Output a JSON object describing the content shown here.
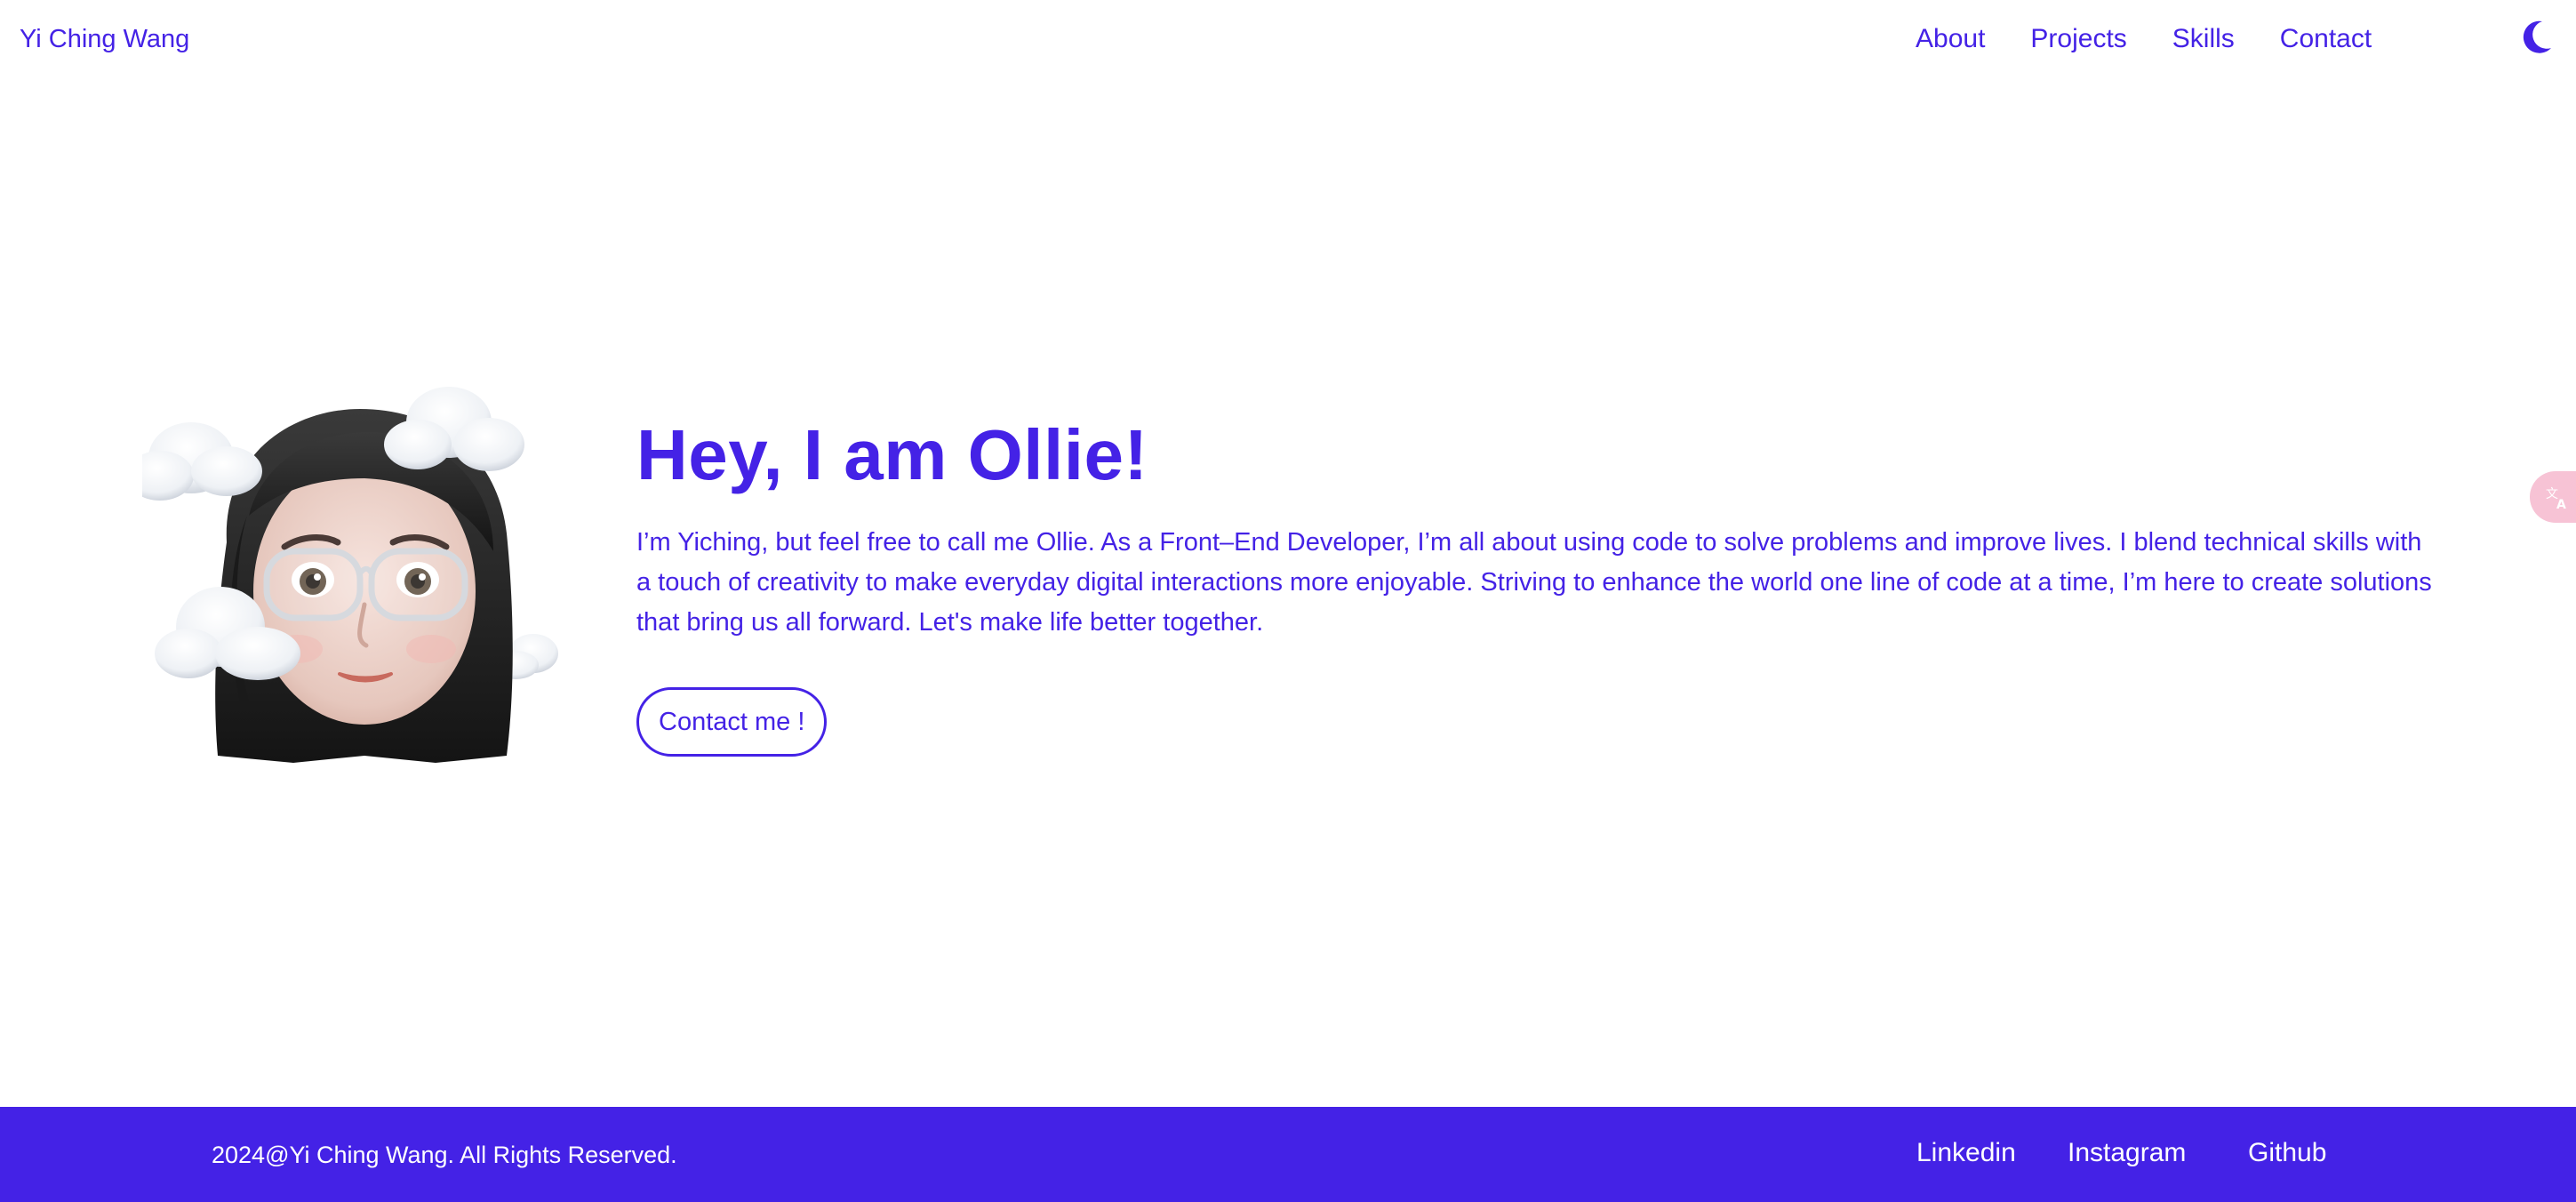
{
  "header": {
    "brand": "Yi Ching Wang",
    "nav": [
      {
        "label": "About"
      },
      {
        "label": "Projects"
      },
      {
        "label": "Skills"
      },
      {
        "label": "Contact"
      }
    ]
  },
  "hero": {
    "title": "Hey, I am Ollie!",
    "description": "I’m Yiching, but feel free to call me Ollie. As a Front–End Developer, I’m all about using code to solve problems and improve lives. I blend technical skills with a touch of creativity to make everyday digital interactions more enjoyable. Striving to enhance the world one line of code at a time, I’m here to create solutions that bring us all forward. Let's make life better together.",
    "cta_label": "Contact me !"
  },
  "footer": {
    "copyright": "2024@Yi Ching Wang. All Rights Reserved.",
    "links": [
      {
        "label": "Linkedin"
      },
      {
        "label": "Instagram"
      },
      {
        "label": "Github"
      }
    ]
  },
  "icons": {
    "theme_toggle": "moon-icon",
    "translate": "translate-icon",
    "avatar": "memoji-avatar"
  },
  "colors": {
    "accent": "#4422e6",
    "background": "#ffffff",
    "footer_text": "#ffffff",
    "translate_tab": "#f7c3d5"
  }
}
